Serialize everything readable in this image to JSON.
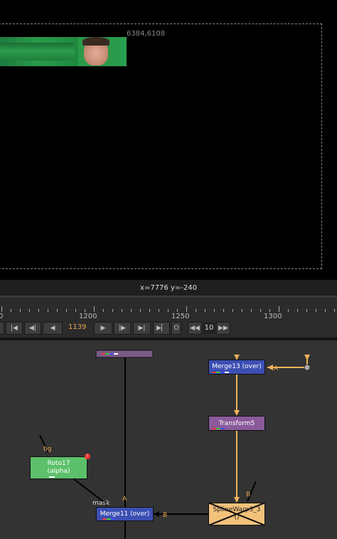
{
  "viewer": {
    "top_right_coord": "6384,6108",
    "bottom_readout": "x=7776 y=-240"
  },
  "timeline": {
    "ticks": [
      "0",
      "1200",
      "1250",
      "1300"
    ]
  },
  "controls": {
    "current_frame": "1139",
    "increment": "10",
    "buttons": [
      "goto-start",
      "prev-key",
      "prev-frame",
      "play-back",
      "play-forward",
      "next-frame",
      "next-key",
      "goto-end",
      "loop",
      "prev-increment",
      "next-increment"
    ]
  },
  "nodegraph": {
    "nodes": {
      "merge13": "Merge13 (over)",
      "transform5": "Transform5",
      "roto17_line1": "Roto17",
      "roto17_line2": "(alpha)",
      "merge11": "Merge11 (over)",
      "splinewarp_line1": "SplineWarp3_3",
      "splinewarp_line2": "()"
    },
    "edge_labels": {
      "merge13_A": "A",
      "roto_bg": "bg",
      "mask": "mask",
      "merge11_A": "A",
      "merge11_B": "B",
      "splinewarp_B": "B",
      "merge11_top_A": "A"
    }
  },
  "colors": {
    "merge_node": "#3c4fb4",
    "transform_node": "#8a5a9a",
    "roto_node": "#5cc06a",
    "splinewarp_node": "#f3c27a",
    "edge_orange": "#f3b35c",
    "frame_text": "#e8a74d"
  }
}
